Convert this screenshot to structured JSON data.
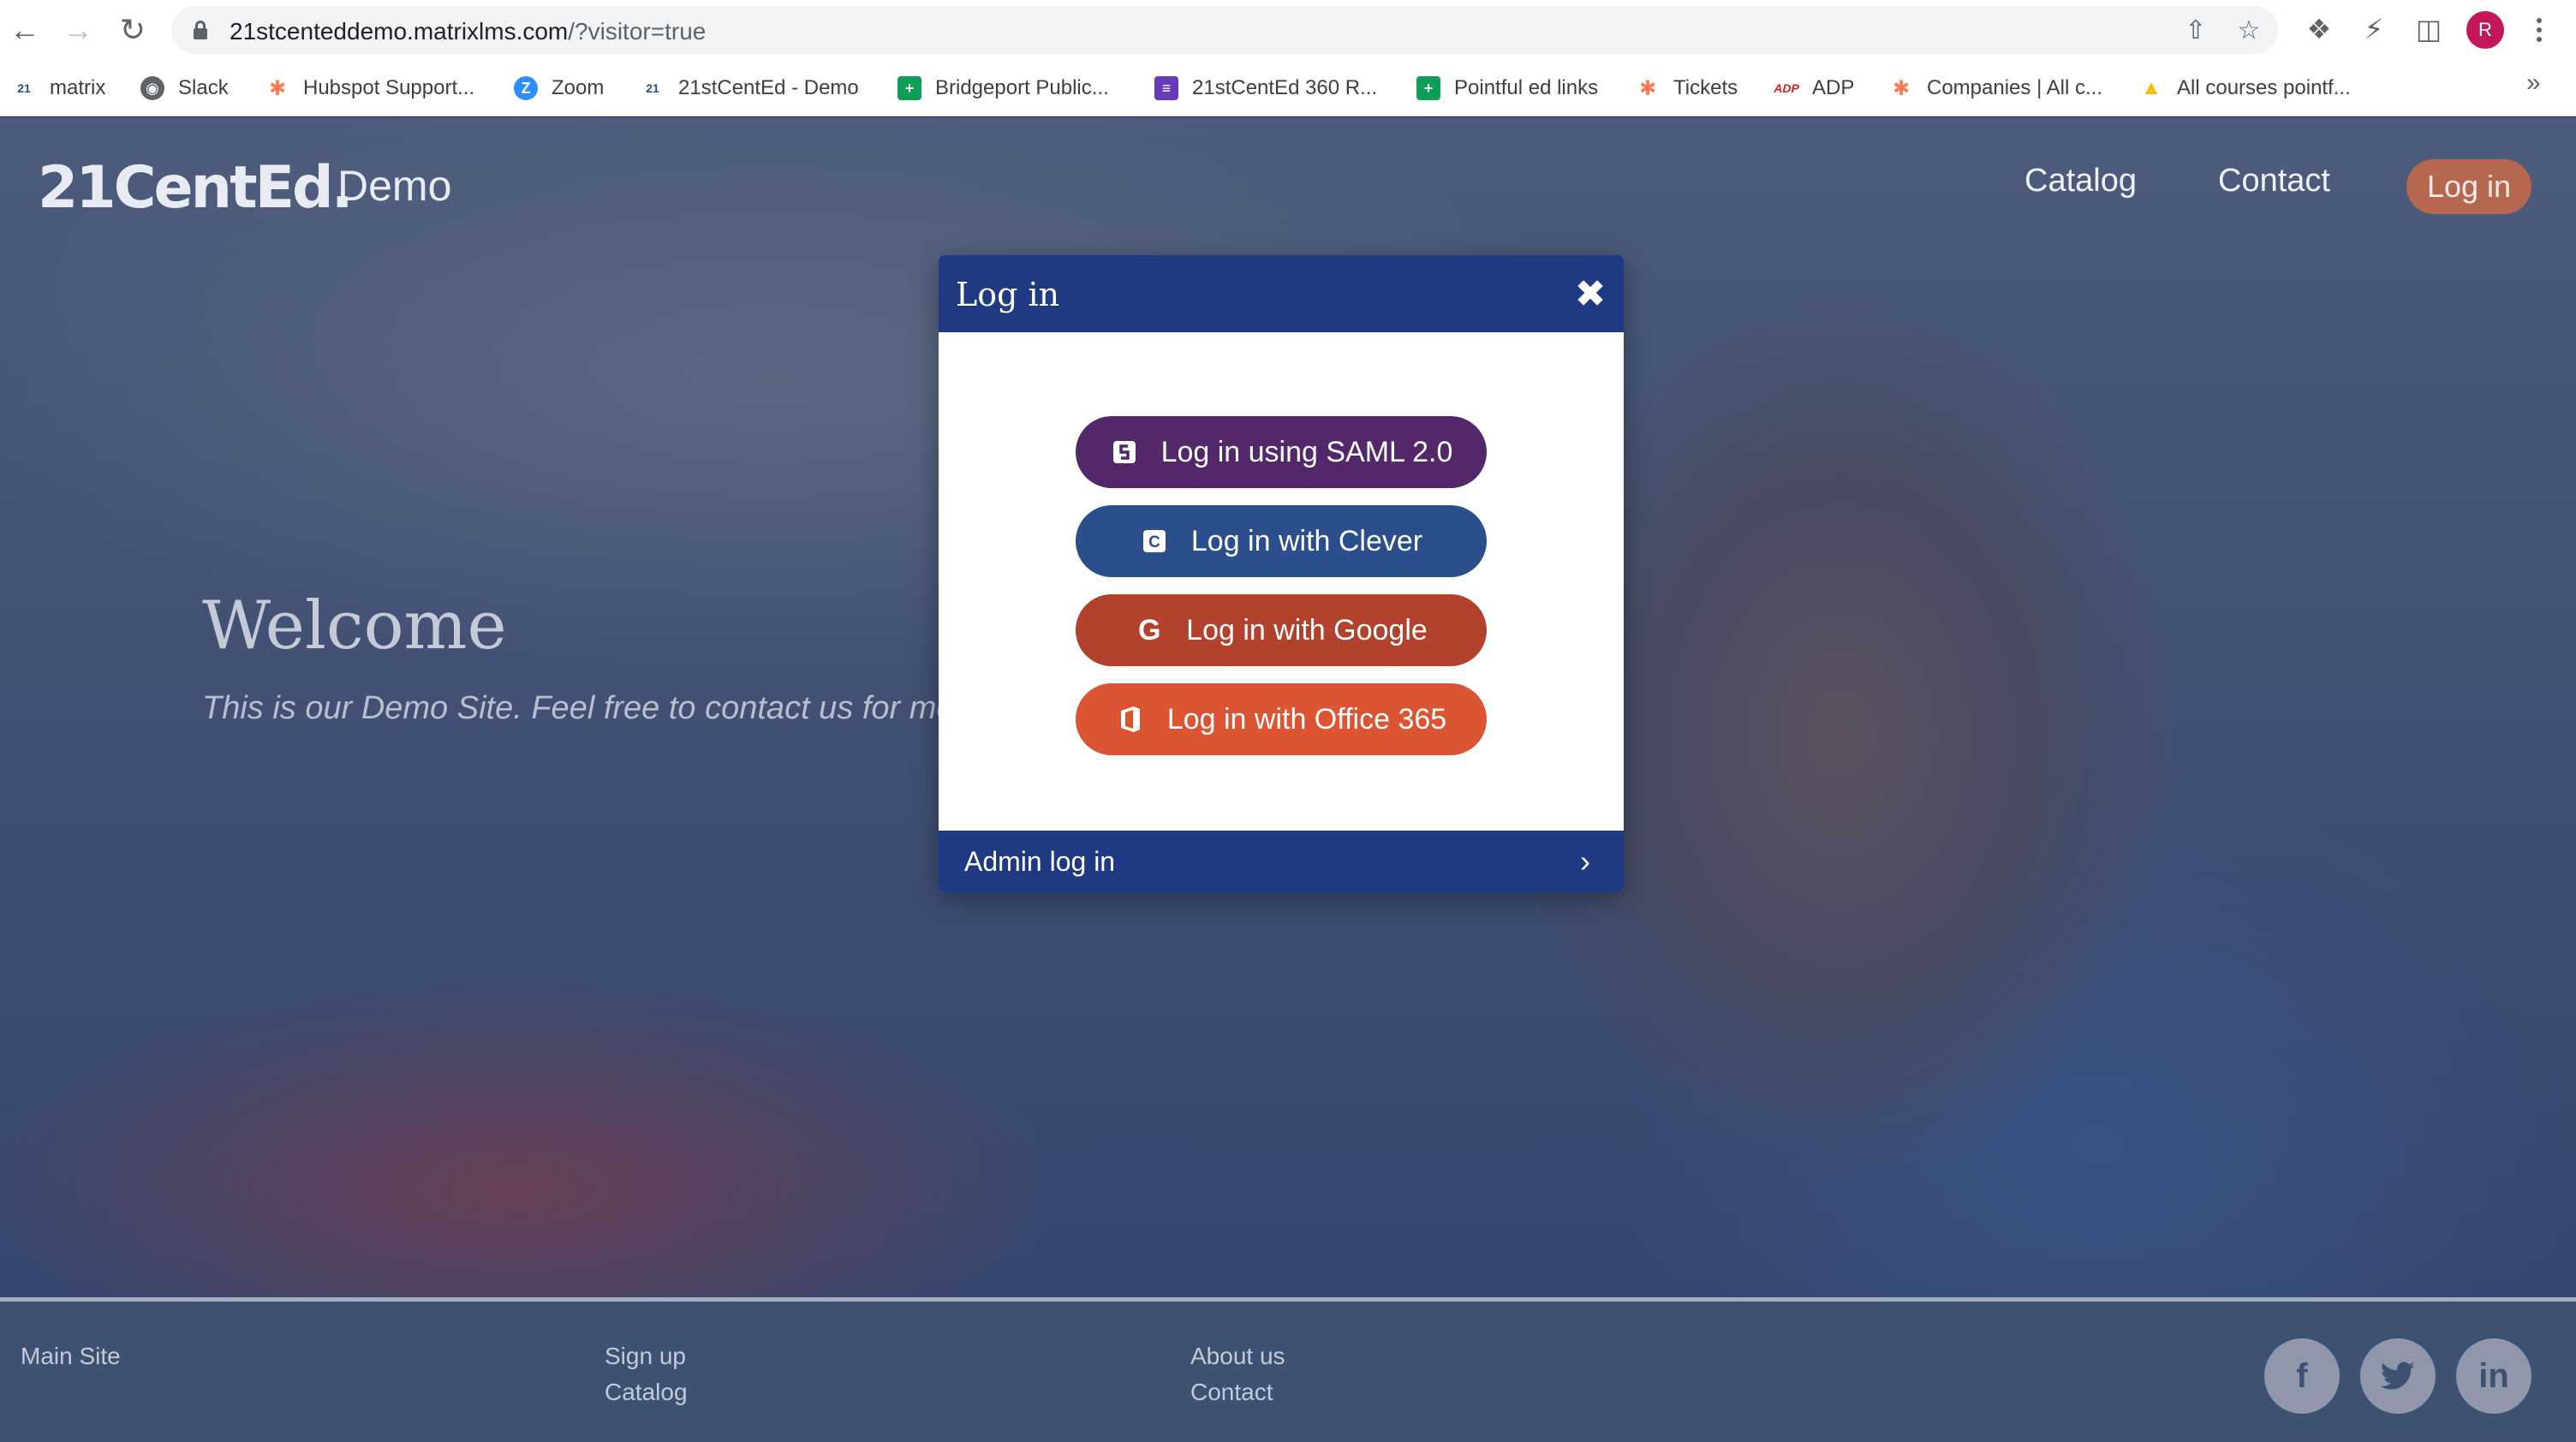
{
  "browser": {
    "url_host": "21stcenteddemo.matrixlms.com",
    "url_path": "/?visitor=true",
    "profile_initial": "R",
    "bookmarks": [
      {
        "label": "matrix",
        "icon": "21ce-icon",
        "color": "#2a4e8c"
      },
      {
        "label": "Slack",
        "icon": "globe-icon",
        "color": "#5f6368"
      },
      {
        "label": "Hubspot Support...",
        "icon": "hubspot-icon",
        "color": "#ff7a59"
      },
      {
        "label": "Zoom",
        "icon": "zoom-icon",
        "color": "#2d8cff"
      },
      {
        "label": "21stCentEd - Demo",
        "icon": "21ce-icon",
        "color": "#2a4e8c"
      },
      {
        "label": "Bridgeport Public...",
        "icon": "sheets-icon",
        "color": "#0f9d58"
      },
      {
        "label": "21stCentEd 360 R...",
        "icon": "forms-icon",
        "color": "#673ab7"
      },
      {
        "label": "Pointful ed links",
        "icon": "sheets-icon",
        "color": "#0f9d58"
      },
      {
        "label": "Tickets",
        "icon": "hubspot-icon",
        "color": "#ff7a59"
      },
      {
        "label": "ADP",
        "icon": "adp-icon",
        "color": "#d0271d"
      },
      {
        "label": "Companies | All c...",
        "icon": "hubspot-icon",
        "color": "#ff7a59"
      },
      {
        "label": "All courses pointf...",
        "icon": "drive-icon",
        "color": "#fbbc04"
      }
    ]
  },
  "site": {
    "logo": "21CentEd.",
    "logo_sub": "Demo",
    "nav": {
      "catalog": "Catalog",
      "contact": "Contact",
      "login": "Log in"
    },
    "hero": {
      "title": "Welcome",
      "tagline": "This is our Demo Site. Feel free to contact us for more information."
    },
    "footer": {
      "main_site": "Main Site",
      "sign_up": "Sign up",
      "catalog": "Catalog",
      "about_us": "About us",
      "contact": "Contact",
      "social": [
        "f",
        "t",
        "in"
      ]
    }
  },
  "modal": {
    "title": "Log in",
    "buttons": {
      "saml": "Log in using SAML 2.0",
      "clever": "Log in with Clever",
      "google": "Log in with Google",
      "office": "Log in with Office 365"
    },
    "admin_label": "Admin log in"
  }
}
